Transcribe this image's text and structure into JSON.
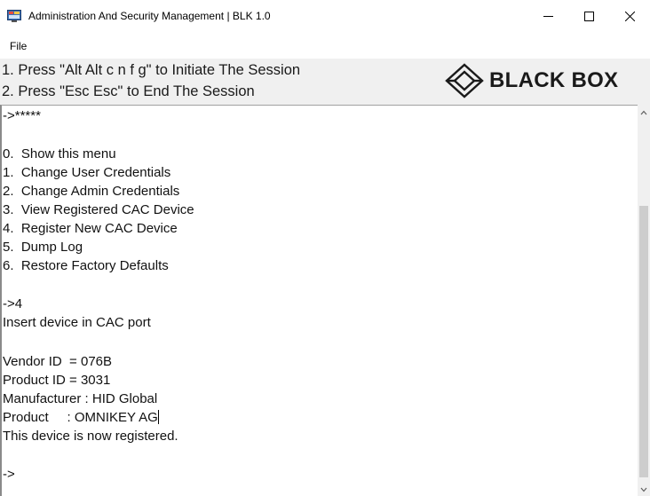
{
  "window": {
    "title": "Administration And Security Management | BLK 1.0",
    "minimize_icon": "minimize-icon",
    "maximize_icon": "maximize-icon",
    "close_icon": "close-icon"
  },
  "menu": {
    "file_label": "File"
  },
  "instructions": {
    "line1": "1. Press \"Alt Alt c n f g\" to Initiate The Session",
    "line2": "2. Press \"Esc Esc\" to End The Session"
  },
  "logo": {
    "text": "BLACK BOX",
    "icon": "black-box-diamond-logo"
  },
  "console": {
    "lines": [
      "->*****",
      "",
      "0.  Show this menu",
      "1.  Change User Credentials",
      "2.  Change Admin Credentials",
      "3.  View Registered CAC Device",
      "4.  Register New CAC Device",
      "5.  Dump Log",
      "6.  Restore Factory Defaults",
      "",
      "->4",
      "Insert device in CAC port",
      "",
      "Vendor ID  = 076B",
      "Product ID = 3031",
      "Manufacturer : HID Global",
      "Product     : OMNIKEY AG",
      "This device is now registered.",
      "",
      "->"
    ]
  },
  "scrollbar": {
    "up_icon": "chevron-up-icon",
    "down_icon": "chevron-down-icon"
  }
}
